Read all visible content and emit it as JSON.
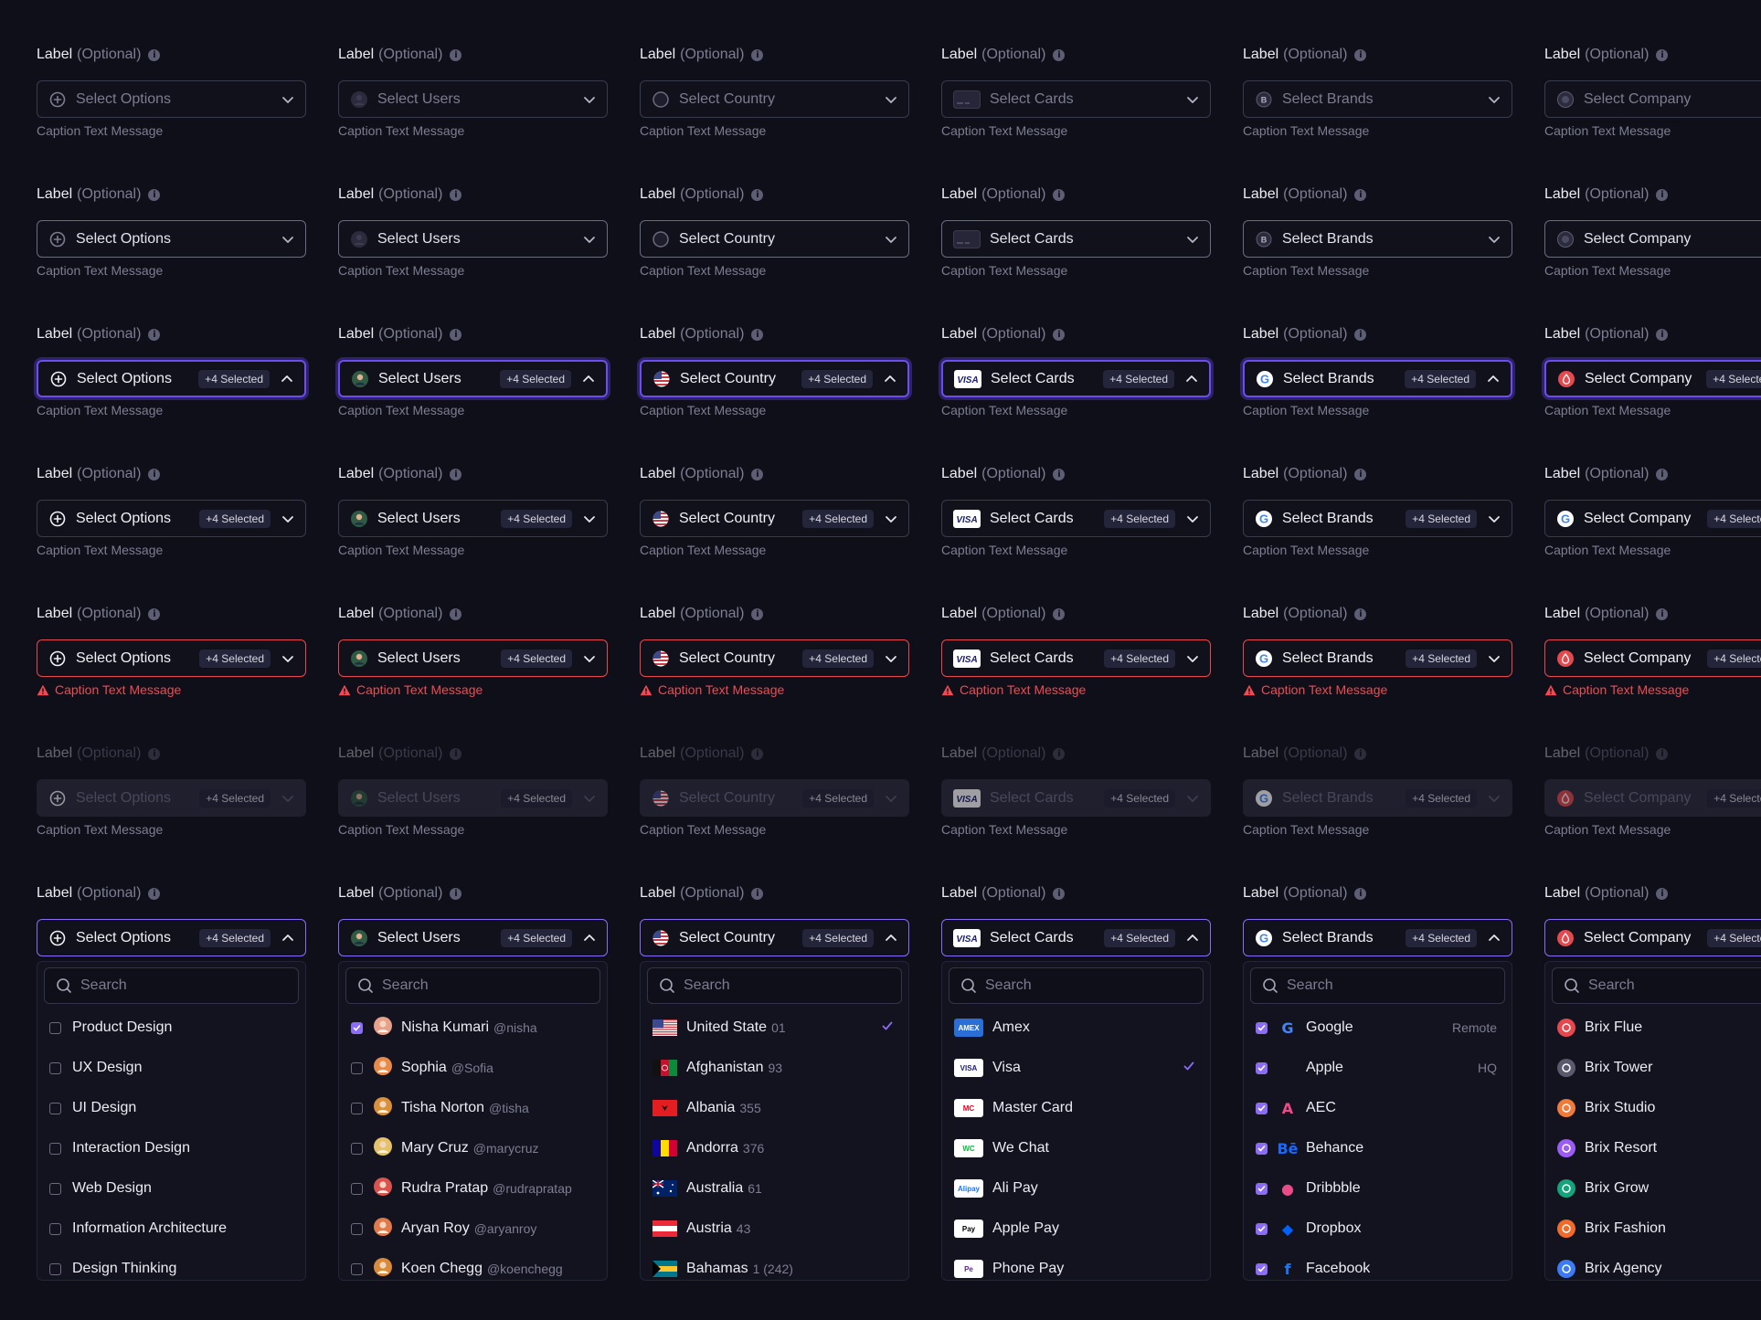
{
  "common": {
    "label": "Label",
    "optional": "(Optional)",
    "caption": "Caption Text Message",
    "selected_badge": "+4 Selected",
    "search_placeholder": "Search"
  },
  "columns": [
    {
      "placeholder": "Select Options",
      "icon": "plus-circle-icon"
    },
    {
      "placeholder": "Select Users",
      "icon": "user-avatar-icon"
    },
    {
      "placeholder": "Select Country",
      "icon": "us-flag-icon"
    },
    {
      "placeholder": "Select Cards",
      "icon": "visa-card-icon"
    },
    {
      "placeholder": "Select Brands",
      "icon": "google-logo-icon"
    },
    {
      "placeholder": "Select Company",
      "icon": "brix-logo-icon"
    }
  ],
  "states": [
    "default",
    "hover",
    "focus",
    "filled",
    "error",
    "disabled",
    "open"
  ],
  "menus": {
    "options": [
      {
        "label": "Product Design",
        "checked": false
      },
      {
        "label": "UX Design",
        "checked": false
      },
      {
        "label": "UI Design",
        "checked": false
      },
      {
        "label": "Interaction Design",
        "checked": false
      },
      {
        "label": "Web Design",
        "checked": false
      },
      {
        "label": "Information Architecture",
        "checked": false
      },
      {
        "label": "Design Thinking",
        "checked": false
      }
    ],
    "users": [
      {
        "name": "Nisha Kumari",
        "handle": "@nisha",
        "checked": true,
        "color": "#e7a08a"
      },
      {
        "name": "Sophia",
        "handle": "@Sofia",
        "checked": false,
        "color": "#e88a4a"
      },
      {
        "name": "Tisha Norton",
        "handle": "@tisha",
        "checked": false,
        "color": "#d9913c"
      },
      {
        "name": "Mary Cruz",
        "handle": "@marycruz",
        "checked": false,
        "color": "#e4c26a"
      },
      {
        "name": "Rudra Pratap",
        "handle": "@rudrapratap",
        "checked": false,
        "color": "#d9534f"
      },
      {
        "name": "Aryan Roy",
        "handle": "@aryanroy",
        "checked": false,
        "color": "#e07a4a"
      },
      {
        "name": "Koen Chegg",
        "handle": "@koenchegg",
        "checked": false,
        "color": "#d98a3a"
      }
    ],
    "countries": [
      {
        "name": "United State",
        "code": "01",
        "checked": true,
        "flag": "us"
      },
      {
        "name": "Afghanistan",
        "code": "93",
        "checked": false,
        "flag": "af"
      },
      {
        "name": "Albania",
        "code": "355",
        "checked": false,
        "flag": "al"
      },
      {
        "name": "Andorra",
        "code": "376",
        "checked": false,
        "flag": "ad"
      },
      {
        "name": "Australia",
        "code": "61",
        "checked": false,
        "flag": "au"
      },
      {
        "name": "Austria",
        "code": "43",
        "checked": false,
        "flag": "at"
      },
      {
        "name": "Bahamas",
        "code": "1 (242)",
        "checked": false,
        "flag": "bs"
      }
    ],
    "cards": [
      {
        "name": "Amex",
        "checked": false,
        "bg": "#2b6fd6",
        "fg": "#ffffff",
        "mark": "AMEX"
      },
      {
        "name": "Visa",
        "checked": true,
        "bg": "#ffffff",
        "fg": "#1a1f71",
        "mark": "VISA"
      },
      {
        "name": "Master Card",
        "checked": false,
        "bg": "#ffffff",
        "fg": "#eb001b",
        "mark": "MC"
      },
      {
        "name": "We Chat",
        "checked": false,
        "bg": "#ffffff",
        "fg": "#09b83e",
        "mark": "WC"
      },
      {
        "name": "Ali Pay",
        "checked": false,
        "bg": "#ffffff",
        "fg": "#1677ff",
        "mark": "Alipay"
      },
      {
        "name": "Apple Pay",
        "checked": false,
        "bg": "#ffffff",
        "fg": "#000000",
        "mark": "Pay"
      },
      {
        "name": "Phone Pay",
        "checked": false,
        "bg": "#ffffff",
        "fg": "#5f259f",
        "mark": "Pe"
      }
    ],
    "brands": [
      {
        "name": "Google",
        "tag": "Remote",
        "checked": true,
        "color": "#4285f4",
        "glyph": "G"
      },
      {
        "name": "Apple",
        "tag": "HQ",
        "checked": true,
        "color": "#9a9aa8",
        "glyph": ""
      },
      {
        "name": "AEC",
        "tag": "",
        "checked": true,
        "color": "#ea4c89",
        "glyph": "A"
      },
      {
        "name": "Behance",
        "tag": "",
        "checked": true,
        "color": "#1769ff",
        "glyph": "Bē"
      },
      {
        "name": "Dribbble",
        "tag": "",
        "checked": true,
        "color": "#ea4c89",
        "glyph": "●"
      },
      {
        "name": "Dropbox",
        "tag": "",
        "checked": true,
        "color": "#0061ff",
        "glyph": "◆"
      },
      {
        "name": "Facebook",
        "tag": "",
        "checked": true,
        "color": "#1877f2",
        "glyph": "f"
      }
    ],
    "companies": [
      {
        "name": "Brix Flue",
        "color": "#e5484d"
      },
      {
        "name": "Brix Tower",
        "color": "#5a5a6c"
      },
      {
        "name": "Brix Studio",
        "color": "#f07a3a"
      },
      {
        "name": "Brix Resort",
        "color": "#9b5cf5"
      },
      {
        "name": "Brix Grow",
        "color": "#14a37a"
      },
      {
        "name": "Brix Fashion",
        "color": "#f06a2a"
      },
      {
        "name": "Brix Agency",
        "color": "#3d7bf5"
      }
    ]
  }
}
